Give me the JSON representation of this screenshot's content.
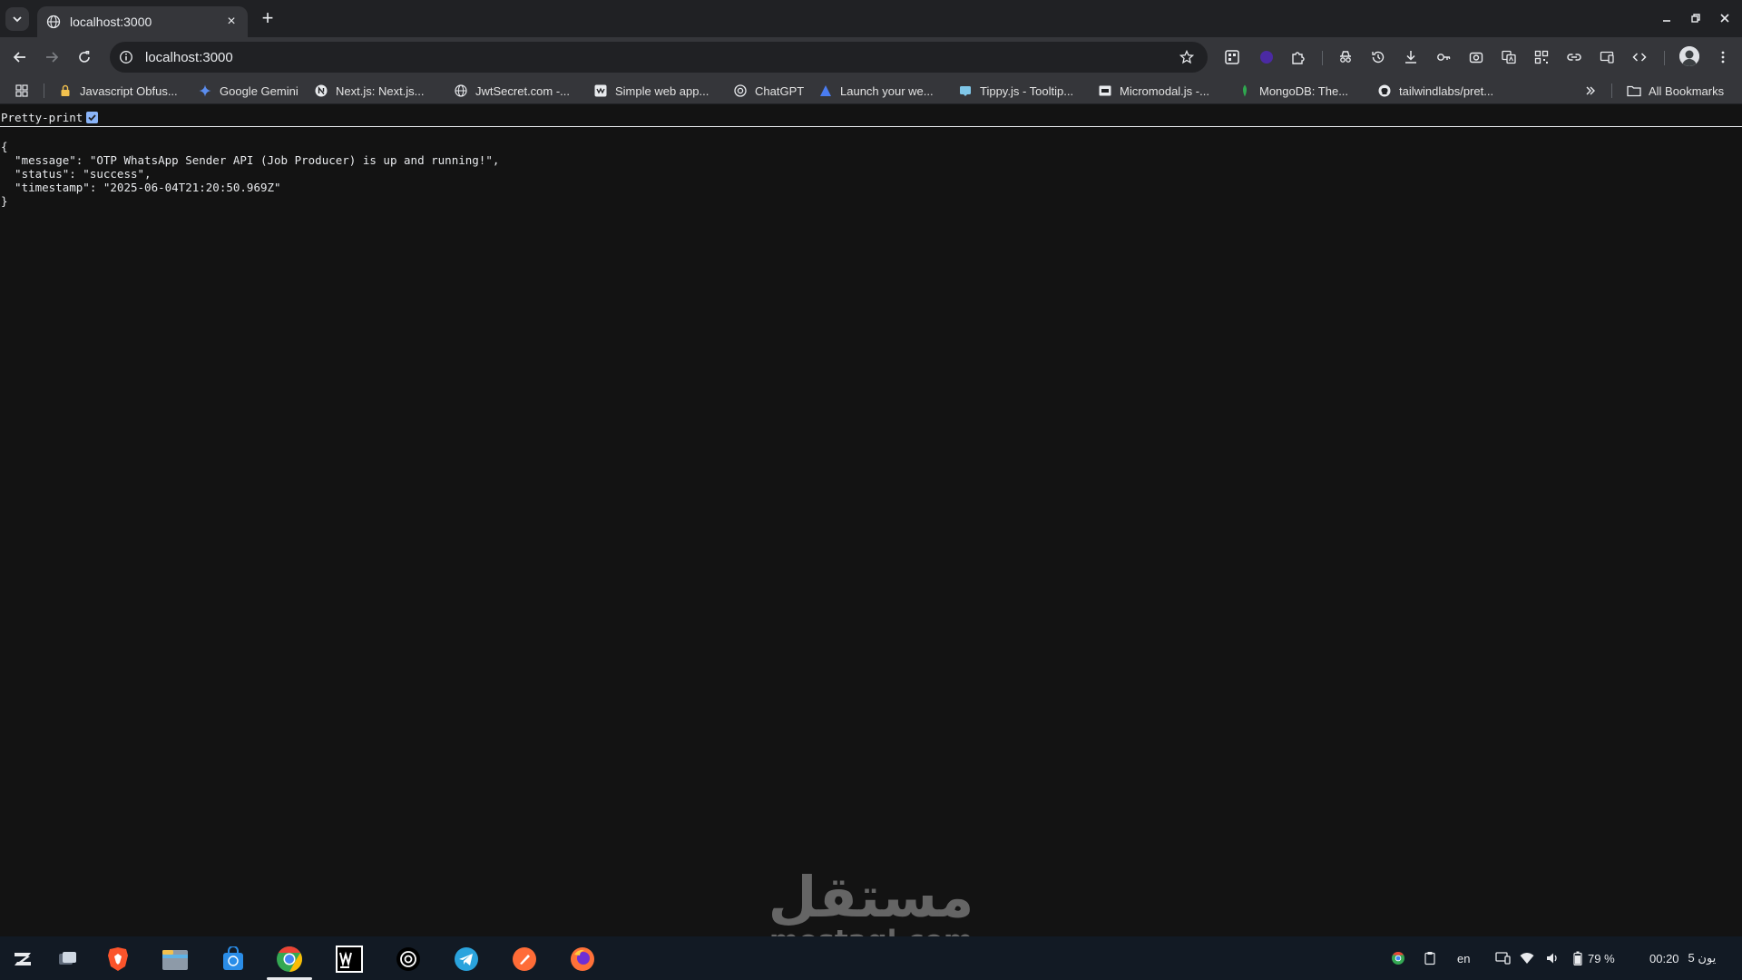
{
  "tab": {
    "title": "localhost:3000",
    "close_label": "×"
  },
  "new_tab_label": "+",
  "address_bar": {
    "url": "localhost:3000"
  },
  "extensions": {
    "badge_count": "10"
  },
  "bookmarks": [
    {
      "label": "Javascript Obfus...",
      "icon": "lock-icon"
    },
    {
      "label": "Google Gemini",
      "icon": "gemini-icon"
    },
    {
      "label": "Next.js: Next.js...",
      "icon": "nextjs-icon"
    },
    {
      "label": "JwtSecret.com -...",
      "icon": "globe-icon"
    },
    {
      "label": "Simple web app...",
      "icon": "webapp-icon"
    },
    {
      "label": "ChatGPT",
      "icon": "chatgpt-icon"
    },
    {
      "label": "Launch your we...",
      "icon": "launch-icon"
    },
    {
      "label": "Tippy.js - Tooltip...",
      "icon": "tippy-icon"
    },
    {
      "label": "Micromodal.js -...",
      "icon": "micromodal-icon"
    },
    {
      "label": "MongoDB: The...",
      "icon": "mongodb-icon"
    },
    {
      "label": "tailwindlabs/pret...",
      "icon": "github-icon"
    }
  ],
  "all_bookmarks_label": "All Bookmarks",
  "viewer": {
    "pretty_print_label": "Pretty-print",
    "json_text": "{\n  \"message\": \"OTP WhatsApp Sender API (Job Producer) is up and running!\",\n  \"status\": \"success\",\n  \"timestamp\": \"2025-06-04T21:20:50.969Z\"\n}"
  },
  "watermark": {
    "arabic": "مستقل",
    "latin": "mostaql.com"
  },
  "taskbar": {
    "language": "en",
    "battery": "79 %",
    "time": "00:20",
    "date": "يون 5"
  },
  "colors": {
    "accent_blue": "#8ab4f8",
    "page_bg": "#131313",
    "toolbar_bg": "#35363a",
    "taskbar_bg": "#121a24"
  }
}
